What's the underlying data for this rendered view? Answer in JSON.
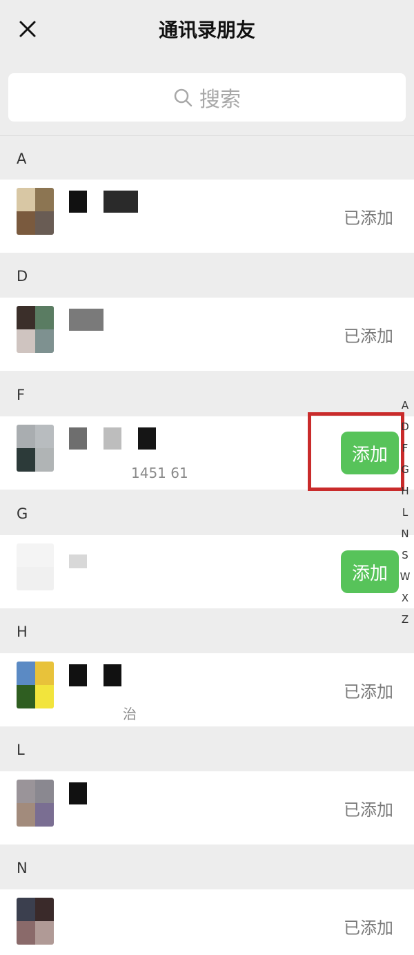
{
  "header": {
    "title": "通讯录朋友",
    "close_icon": "close-icon"
  },
  "search": {
    "placeholder": "搜索",
    "icon": "search-icon"
  },
  "sections": [
    {
      "letter": "A",
      "status": "已添加"
    },
    {
      "letter": "D",
      "status": "已添加"
    },
    {
      "letter": "F",
      "status": "添加",
      "sub": "1451 61"
    },
    {
      "letter": "G",
      "status": "添加"
    },
    {
      "letter": "H",
      "status": "已添加",
      "sub": "治"
    },
    {
      "letter": "L",
      "status": "已添加"
    },
    {
      "letter": "N",
      "status": "已添加"
    }
  ],
  "index_letters": [
    "A",
    "D",
    "F",
    "G",
    "H",
    "L",
    "N",
    "S",
    "W",
    "X",
    "Z"
  ],
  "colors": {
    "add_button": "#57c35a",
    "highlight_border": "#c92b2b",
    "background": "#ededed"
  }
}
